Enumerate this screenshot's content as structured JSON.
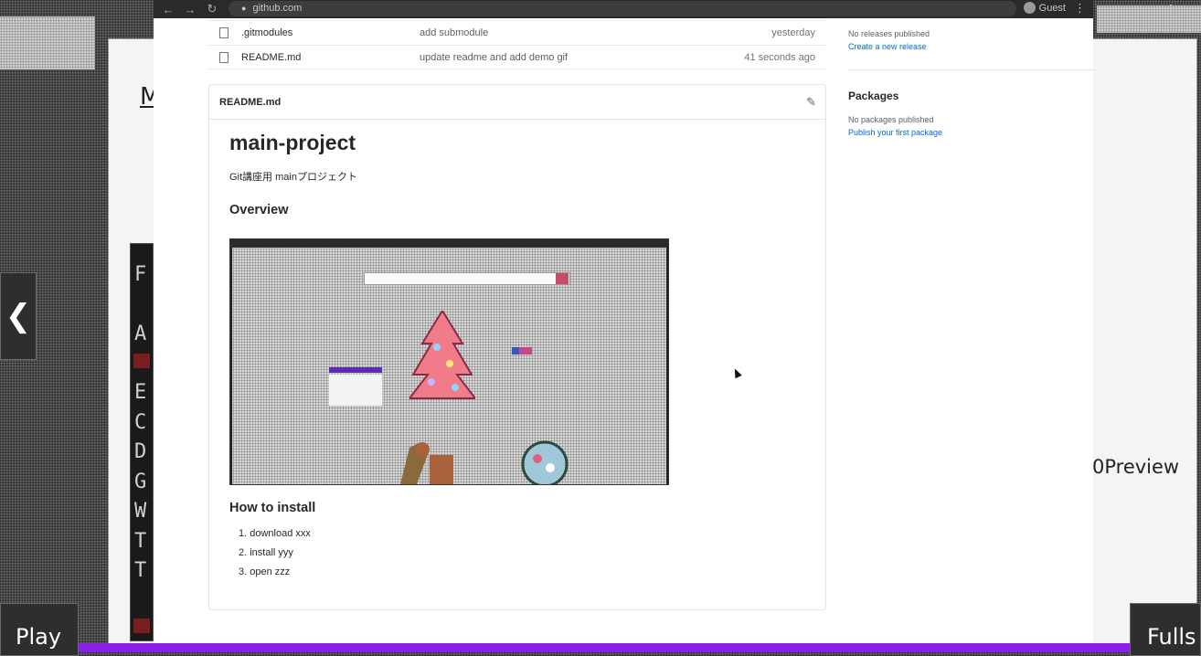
{
  "browser": {
    "url": "github.com",
    "account": "Guest"
  },
  "backdrop": {
    "underlined_letter": "M",
    "preview_text": "0Preview",
    "side_letters": [
      "F",
      "A",
      "E",
      "C",
      "D",
      "G",
      "W",
      "T",
      "T"
    ]
  },
  "files": [
    {
      "name": ".gitmodules",
      "message": "add submodule",
      "date": "yesterday"
    },
    {
      "name": "README.md",
      "message": "update readme and add demo gif",
      "date": "41 seconds ago"
    }
  ],
  "readme": {
    "filename": "README.md",
    "title": "main-project",
    "description": "Git講座用 mainプロジェクト",
    "overview_heading": "Overview",
    "install_heading": "How to install",
    "install_steps": [
      "1. download xxx",
      "2. install yyy",
      "3. open zzz"
    ]
  },
  "sidebar": {
    "releases_text": "No releases published",
    "releases_link": "Create a new release",
    "packages_heading": "Packages",
    "packages_text": "No packages published",
    "packages_link": "Publish your first package"
  },
  "player": {
    "play_label": "Play",
    "fullscreen_label": "Fulls",
    "progress": 1.0,
    "accent_color": "#8a20e8"
  }
}
